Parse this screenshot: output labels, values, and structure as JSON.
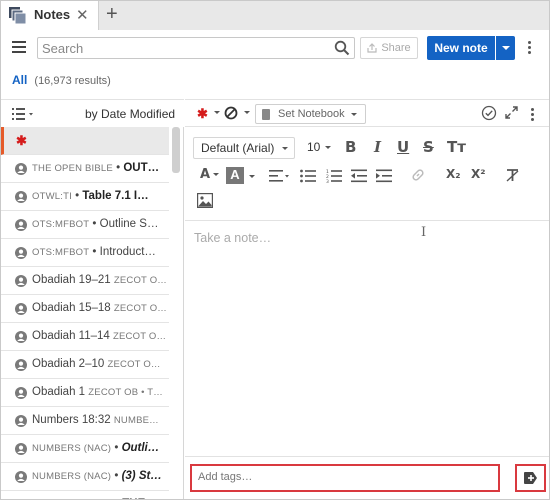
{
  "tab": {
    "title": "Notes",
    "close_glyph": "✕",
    "new_tab_glyph": "+",
    "icon": "notes-stack-icon"
  },
  "toolbar": {
    "menu_icon": "hamburger-menu-icon",
    "search_placeholder": "Search",
    "search_icon": "search-icon",
    "share_label": "Share",
    "share_icon": "share-upload-icon",
    "new_note_label": "New note",
    "more_icon": "vertical-ellipsis-icon",
    "accent_color": "#1463c4"
  },
  "filter": {
    "scope": "All",
    "results": "(16,973 results)"
  },
  "list_header": {
    "view_icon": "list-view-icon",
    "sort_label": "by Date Modified"
  },
  "notes": [
    {
      "selected": true,
      "star": "✱",
      "source": "",
      "sep": "",
      "title": ""
    },
    {
      "source": "THE OPEN BIBLE",
      "sep": " • ",
      "title": "OUT…",
      "style": "bold"
    },
    {
      "source": "OTWL:TI",
      "sep": " • ",
      "title": "Table 7.1 I…",
      "style": "bold"
    },
    {
      "source": "OTS:MFBOT",
      "sep": " • ",
      "title": "Outline S…",
      "style": "plain"
    },
    {
      "source": "OTS:MFBOT",
      "sep": " • ",
      "title": "Introduct…",
      "style": "plain"
    },
    {
      "source": "Obadiah 19–21",
      "sep": " ",
      "title": "ZECOT O…",
      "style": "sub"
    },
    {
      "source": "Obadiah 15–18",
      "sep": " ",
      "title": "ZECOT O…",
      "style": "sub"
    },
    {
      "source": "Obadiah 11–14",
      "sep": " ",
      "title": "ZECOT O…",
      "style": "sub"
    },
    {
      "source": "Obadiah 2–10",
      "sep": " ",
      "title": "ZECOT O…",
      "style": "sub"
    },
    {
      "source": "Obadiah 1",
      "sep": " ",
      "title": "ZECOT OB • T…",
      "style": "sub"
    },
    {
      "source": "Numbers 18:32",
      "sep": " ",
      "title": "NUMBE…",
      "style": "sub"
    },
    {
      "source": "NUMBERS (NAC)",
      "sep": " • ",
      "title": "Outli…",
      "style": "italic"
    },
    {
      "source": "NUMBERS (NAC)",
      "sep": " • ",
      "title": "(3) St…",
      "style": "italic"
    },
    {
      "source": "NIVCBSB:BLAWS",
      "sep": " • ",
      "title": "THE …",
      "style": "bold"
    }
  ],
  "editor": {
    "star": "✱",
    "block_icon": "no-entry-icon",
    "notebook_label": "Set Notebook",
    "check_icon": "check-circle-icon",
    "expand_icon": "expand-arrows-icon",
    "more_icon": "vertical-ellipsis-icon",
    "font_family": "Default (Arial)",
    "font_size": "10",
    "placeholder": "Take a note…",
    "tags_placeholder": "Add tags…",
    "add_tag_icon": "tag-add-icon",
    "highlight_color": "#d9393f"
  },
  "format": {
    "bold": "B",
    "italic": "I",
    "underline": "U",
    "strike": "S",
    "text_size": "Tт",
    "font_color": "A",
    "highlight": "A",
    "subscript": "X₂",
    "superscript": "X²",
    "clear_format": "T̸"
  }
}
